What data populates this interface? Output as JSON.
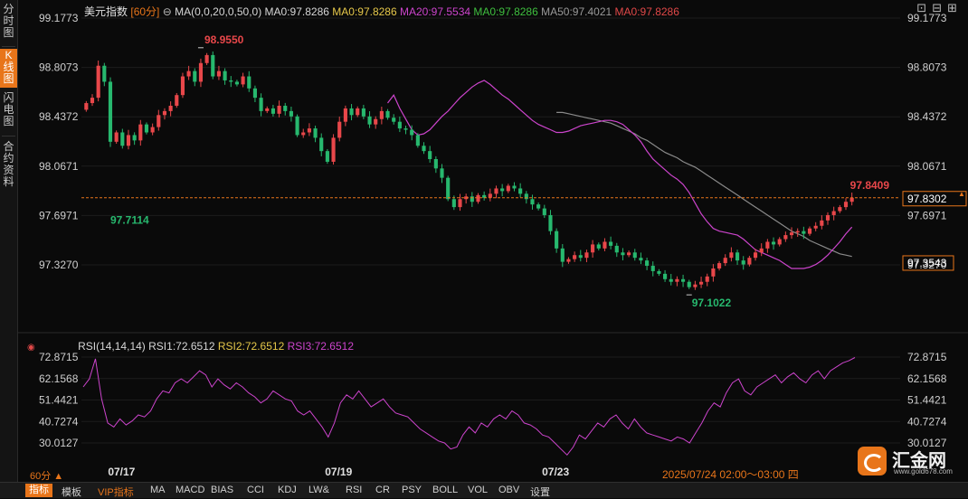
{
  "tabs": [
    "分时图",
    "K线图",
    "闪电图",
    "合约资料"
  ],
  "active_tab": 1,
  "header": {
    "symbol": "美元指数",
    "period_badge": "[60分]",
    "ma_params": "MA(0,0,20,0,50,0)",
    "ma_items": [
      {
        "text": "MA0:97.8286",
        "color": "#d7d7d7"
      },
      {
        "text": "MA0:97.8286",
        "color": "#e6c84a"
      },
      {
        "text": "MA20:97.5534",
        "color": "#cc44cc"
      },
      {
        "text": "MA0:97.8286",
        "color": "#3fbf3f"
      },
      {
        "text": "MA50:97.4021",
        "color": "#9a9a9a"
      },
      {
        "text": "MA0:97.8286",
        "color": "#e04848"
      }
    ],
    "window_controls": [
      "⊡",
      "⊟",
      "⊞"
    ]
  },
  "rsi_header": {
    "label": "RSI(14,14,14)",
    "items": [
      {
        "text": "RSI1:72.6512",
        "color": "#d7d7d7"
      },
      {
        "text": "RSI2:72.6512",
        "color": "#e6c84a"
      },
      {
        "text": "RSI3:72.6512",
        "color": "#cc44cc"
      }
    ]
  },
  "bottom": {
    "period_label": "60分 ▲",
    "cursor_time": "2025/07/24 02:00～03:00 四"
  },
  "toolbar": [
    "指标",
    "模板",
    "VIP指标",
    "MA",
    "MACD",
    "BIAS",
    "CCI",
    "KDJ",
    "LW&",
    "RSI",
    "CR",
    "PSY",
    "BOLL",
    "VOL",
    "OBV",
    "设置"
  ],
  "toolbar_active": 0,
  "logo": {
    "name": "汇金网",
    "url": "www.gold678.com"
  },
  "colors": {
    "up": "#e8474a",
    "down": "#27b86e",
    "ma20": "#cc44cc",
    "ma50": "#8a8a8a",
    "accent": "#e8751a",
    "current": "#e8751a"
  },
  "chart_data": [
    {
      "type": "candlestick",
      "title": "美元指数",
      "period": "60分",
      "y_ticks": [
        99.1773,
        98.8073,
        98.4372,
        98.0671,
        97.6971,
        97.327
      ],
      "y_tick_labels": [
        "99.1773",
        "98.8073",
        "98.4372",
        "98.0671",
        "97.6971",
        "97.3270"
      ],
      "ylim": [
        97.02,
        99.2
      ],
      "x_labels": [
        {
          "label": "07/17",
          "index": 6
        },
        {
          "label": "07/19",
          "index": 42
        },
        {
          "label": "07/23",
          "index": 78
        }
      ],
      "annotations": {
        "high": {
          "label": "98.9550",
          "value": 98.955,
          "index": 19
        },
        "low_left": {
          "label": "97.7114",
          "value": 97.7114,
          "index": 4
        },
        "low": {
          "label": "97.1022",
          "value": 97.1022,
          "index": 100
        },
        "last_high": {
          "label": "97.8409",
          "value": 97.8409,
          "index": 127
        }
      },
      "current_price": {
        "label": "97.8302",
        "value": 97.8302
      },
      "ma50_tag": {
        "label": "97.3543",
        "value": 97.3543
      },
      "closes": [
        98.54,
        98.58,
        98.82,
        98.7,
        98.25,
        98.32,
        98.22,
        98.3,
        98.26,
        98.38,
        98.32,
        98.36,
        98.45,
        98.48,
        98.52,
        98.6,
        98.74,
        98.78,
        98.7,
        98.84,
        98.9,
        98.74,
        98.78,
        98.71,
        98.7,
        98.68,
        98.74,
        98.65,
        98.58,
        98.48,
        98.5,
        98.46,
        98.52,
        98.48,
        98.44,
        98.3,
        98.32,
        98.35,
        98.28,
        98.18,
        98.1,
        98.28,
        98.4,
        98.5,
        98.45,
        98.5,
        98.44,
        98.38,
        98.42,
        98.48,
        98.43,
        98.4,
        98.35,
        98.34,
        98.3,
        98.22,
        98.18,
        98.12,
        98.05,
        97.98,
        97.82,
        97.76,
        97.82,
        97.84,
        97.8,
        97.85,
        97.83,
        97.86,
        97.9,
        97.88,
        97.92,
        97.9,
        97.86,
        97.82,
        97.78,
        97.75,
        97.7,
        97.58,
        97.45,
        97.35,
        97.37,
        97.4,
        97.38,
        97.42,
        97.48,
        97.45,
        97.5,
        97.47,
        97.42,
        97.4,
        97.42,
        97.38,
        97.36,
        97.32,
        97.28,
        97.26,
        97.22,
        97.2,
        97.22,
        97.2,
        97.16,
        97.18,
        97.2,
        97.24,
        97.3,
        97.34,
        97.38,
        97.42,
        97.36,
        97.33,
        97.38,
        97.42,
        97.45,
        97.5,
        97.48,
        97.52,
        97.55,
        97.57,
        97.58,
        97.56,
        97.6,
        97.62,
        97.66,
        97.7,
        97.73,
        97.76,
        97.8,
        97.83
      ],
      "ma20": [
        98.54,
        98.6,
        98.5,
        98.42,
        98.34,
        98.3,
        98.31,
        98.34,
        98.39,
        98.44,
        98.48,
        98.53,
        98.58,
        98.62,
        98.66,
        98.69,
        98.71,
        98.68,
        98.64,
        98.6,
        98.57,
        98.53,
        98.49,
        98.45,
        98.41,
        98.38,
        98.36,
        98.34,
        98.32,
        98.32,
        98.33,
        98.35,
        98.37,
        98.38,
        98.39,
        98.4,
        98.41,
        98.41,
        98.4,
        98.38,
        98.34,
        98.3,
        98.25,
        98.18,
        98.12,
        98.08,
        98.04,
        98.0,
        97.97,
        97.93,
        97.87,
        97.79,
        97.71,
        97.65,
        97.6,
        97.58,
        97.57,
        97.56,
        97.55,
        97.52,
        97.48,
        97.44,
        97.42,
        97.4,
        97.38,
        97.36,
        97.33,
        97.3,
        97.3,
        97.3,
        97.31,
        97.33,
        97.36,
        97.4,
        97.45,
        97.5,
        97.56,
        97.61
      ],
      "ma20_start": 50,
      "ma50": [
        98.47,
        98.47,
        98.46,
        98.45,
        98.44,
        98.43,
        98.42,
        98.41,
        98.4,
        98.39,
        98.37,
        98.35,
        98.33,
        98.31,
        98.28,
        98.26,
        98.23,
        98.2,
        98.17,
        98.15,
        98.13,
        98.1,
        98.08,
        98.06,
        98.03,
        98.0,
        97.97,
        97.94,
        97.91,
        97.88,
        97.85,
        97.82,
        97.79,
        97.76,
        97.73,
        97.7,
        97.67,
        97.64,
        97.61,
        97.58,
        97.56,
        97.54,
        97.51,
        97.49,
        97.47,
        97.45,
        97.43,
        97.41,
        97.4,
        97.39
      ],
      "ma50_start": 78,
      "rsi": {
        "y_ticks": [
          72.8715,
          62.1568,
          51.4421,
          40.7274,
          30.0127
        ],
        "y_tick_labels": [
          "72.8715",
          "62.1568",
          "51.4421",
          "40.7274",
          "30.0127"
        ],
        "ylim": [
          24,
          76
        ],
        "values": [
          58,
          62,
          72,
          52,
          40,
          38,
          42,
          39,
          41,
          44,
          43,
          46,
          52,
          56,
          55,
          60,
          62,
          60,
          63,
          66,
          64,
          58,
          62,
          59,
          57,
          60,
          58,
          55,
          53,
          50,
          52,
          56,
          54,
          52,
          51,
          46,
          44,
          46,
          42,
          38,
          33,
          40,
          50,
          54,
          52,
          56,
          52,
          48,
          50,
          52,
          48,
          45,
          44,
          43,
          40,
          37,
          35,
          33,
          31,
          30,
          27,
          28,
          34,
          38,
          35,
          40,
          38,
          42,
          44,
          42,
          46,
          44,
          40,
          39,
          37,
          34,
          33,
          30,
          27,
          24,
          28,
          34,
          32,
          36,
          40,
          38,
          42,
          44,
          40,
          37,
          42,
          38,
          35,
          34,
          33,
          32,
          31,
          33,
          32,
          30,
          35,
          40,
          46,
          50,
          48,
          55,
          60,
          62,
          56,
          54,
          58,
          60,
          62,
          64,
          60,
          63,
          65,
          62,
          60,
          64,
          66,
          62,
          66,
          68,
          70,
          71,
          72.65
        ]
      }
    }
  ]
}
